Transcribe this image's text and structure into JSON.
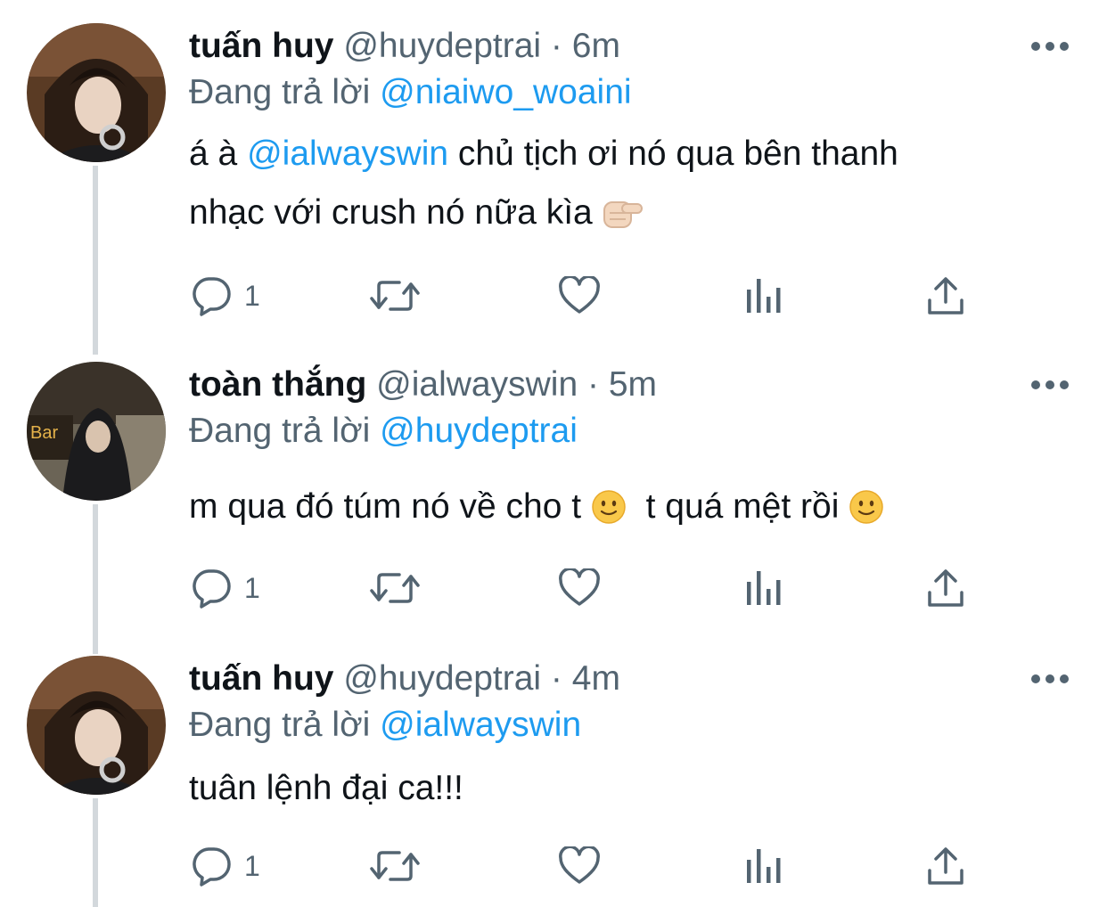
{
  "thread": [
    {
      "name": "tuấn huy",
      "handle": "@huydeptrai",
      "separator": "·",
      "time": "6m",
      "replying_prefix": "Đang trả lời",
      "replying_to": "@niaiwo_woaini",
      "body_line1_pre": "á à",
      "body_mention": "@ialwayswin",
      "body_line1_post": "chủ tịch ơi nó qua bên thanh",
      "body_line2": "nhạc với crush nó nữa kìa",
      "emoji": "backhand-index-pointing-right-emoji",
      "reply_count": "1"
    },
    {
      "name": "toàn thắng",
      "handle": "@ialwayswin",
      "separator": "·",
      "time": "5m",
      "replying_prefix": "Đang trả lời",
      "replying_to": "@huydeptrai",
      "body_part1": "m qua đó túm nó về cho t",
      "body_part2": "t quá mệt rồi",
      "emoji": "slightly-smiling-face-emoji",
      "reply_count": "1"
    },
    {
      "name": "tuấn huy",
      "handle": "@huydeptrai",
      "separator": "·",
      "time": "4m",
      "replying_prefix": "Đang trả lời",
      "replying_to": "@ialwayswin",
      "body": "tuân lệnh đại ca!!!",
      "reply_count": "1"
    }
  ],
  "icons": {
    "reply": "reply-icon",
    "retweet": "retweet-icon",
    "like": "heart-icon",
    "analytics": "analytics-icon",
    "share": "share-icon",
    "more": "more-icon"
  },
  "colors": {
    "name": "#0f1419",
    "meta": "#536471",
    "mention": "#1d9bf0",
    "thread_line": "#d3d8dc",
    "icon": "#536471"
  }
}
